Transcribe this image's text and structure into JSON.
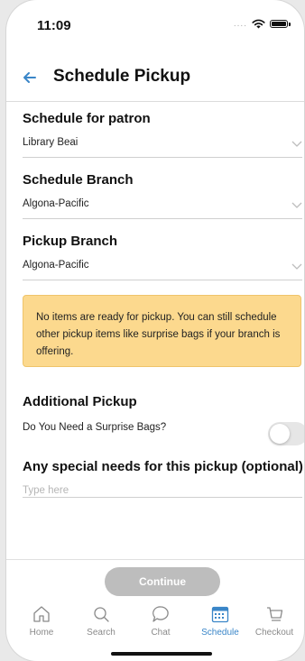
{
  "status_bar": {
    "time": "11:09",
    "signal": "...."
  },
  "header": {
    "title": "Schedule Pickup"
  },
  "patron": {
    "label": "Schedule for patron",
    "value": "Library Beai"
  },
  "schedule_branch": {
    "label": "Schedule Branch",
    "value": "Algona-Pacific"
  },
  "pickup_branch": {
    "label": "Pickup Branch",
    "value": "Algona-Pacific"
  },
  "notice": {
    "line1": "No items are ready for pickup. You can still schedule",
    "line2": "other pickup items like surprise bags if your branch is",
    "line3": "offering."
  },
  "additional_pickup": {
    "title": "Additional Pickup",
    "question": "Do You Need a Surprise Bags?",
    "toggle_on": false
  },
  "special_needs": {
    "title": "Any special needs for this pickup (optional)",
    "placeholder": "Type here",
    "value": ""
  },
  "continue_label": "Continue",
  "tabs": [
    {
      "label": "Home",
      "icon": "home-icon"
    },
    {
      "label": "Search",
      "icon": "search-icon"
    },
    {
      "label": "Chat",
      "icon": "chat-icon"
    },
    {
      "label": "Schedule",
      "icon": "calendar-icon",
      "active": true
    },
    {
      "label": "Checkout",
      "icon": "cart-icon"
    }
  ],
  "colors": {
    "accent": "#3a86c8",
    "notice_bg": "#fcd98e",
    "button_disabled": "#bdbdbd"
  }
}
